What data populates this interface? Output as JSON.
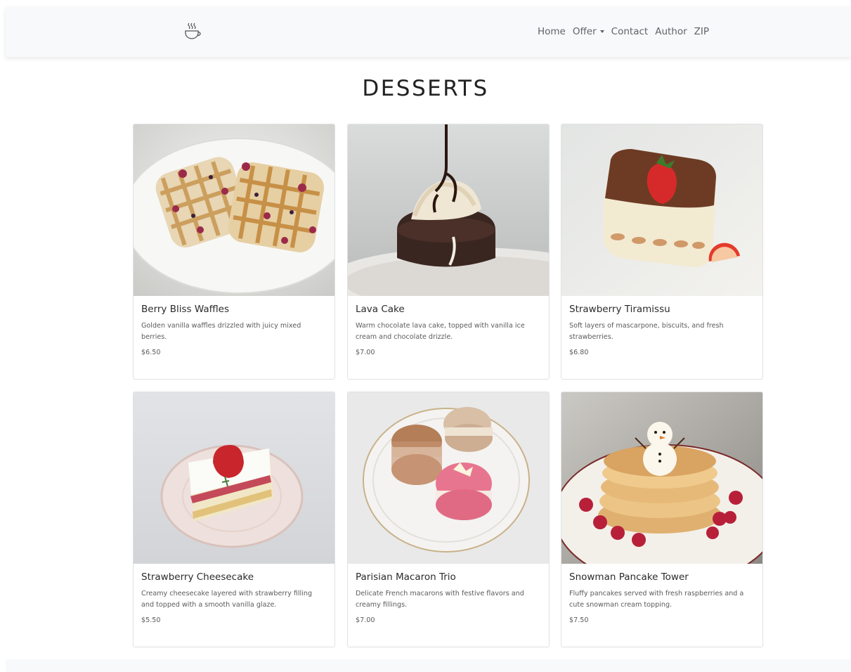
{
  "nav": {
    "brand_icon": "coffee-cup-icon",
    "links": [
      {
        "label": "Home"
      },
      {
        "label": "Offer",
        "dropdown": true
      },
      {
        "label": "Contact"
      },
      {
        "label": "Author"
      },
      {
        "label": "ZIP"
      }
    ]
  },
  "page": {
    "title": "DESSERTS"
  },
  "items": [
    {
      "name": "Berry Bliss Waffles",
      "description": "Golden vanilla waffles drizzled with juicy mixed berries.",
      "price": "$6.50",
      "image": "waffles-photo"
    },
    {
      "name": "Lava Cake",
      "description": "Warm chocolate lava cake, topped with vanilla ice cream and chocolate drizzle.",
      "price": "$7.00",
      "image": "lava-cake-photo"
    },
    {
      "name": "Strawberry Tiramissu",
      "description": "Soft layers of mascarpone, biscuits, and fresh strawberries.",
      "price": "$6.80",
      "image": "tiramisu-photo"
    },
    {
      "name": "Strawberry Cheesecake",
      "description": "Creamy cheesecake layered with strawberry filling and topped with a smooth vanilla glaze.",
      "price": "$5.50",
      "image": "cheesecake-photo"
    },
    {
      "name": "Parisian Macaron Trio",
      "description": "Delicate French macarons with festive flavors and creamy fillings.",
      "price": "$7.00",
      "image": "macarons-photo"
    },
    {
      "name": "Snowman Pancake Tower",
      "description": "Fluffy pancakes served with fresh raspberries and a cute snowman cream topping.",
      "price": "$7.50",
      "image": "pancakes-photo"
    }
  ],
  "colors": {
    "navbar_bg": "#f8f9fa",
    "nav_text": "#5f6368",
    "title_text": "#222222",
    "card_border": "#dfe1e4"
  }
}
